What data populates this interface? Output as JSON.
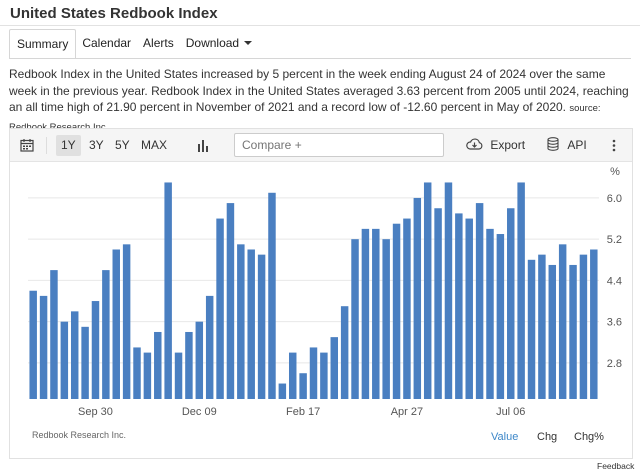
{
  "page": {
    "title": "United States Redbook Index"
  },
  "tabs": [
    {
      "label": "Summary",
      "active": true
    },
    {
      "label": "Calendar"
    },
    {
      "label": "Alerts"
    },
    {
      "label": "Download",
      "dropdown": true
    }
  ],
  "description": {
    "text": "Redbook Index in the United States increased by 5 percent in the week ending August 24 of 2024 over the same week in the previous year. Redbook Index in the United States averaged 3.63 percent from 2005 until 2024, reaching an all time high of 21.90 percent in November of 2021 and a record low of -12.60 percent in May of 2020.",
    "source": "source: Redbook Research Inc."
  },
  "toolbar": {
    "ranges": [
      "1Y",
      "3Y",
      "5Y",
      "MAX"
    ],
    "active_range": "1Y",
    "compare_placeholder": "Compare +",
    "export_label": "Export",
    "api_label": "API",
    "icons": [
      "calendar-icon",
      "bar-chart-icon",
      "cloud-download-icon",
      "database-icon",
      "more-vert-icon"
    ]
  },
  "chart_footer": {
    "source": "Redbook Research Inc.",
    "modes": [
      "Value",
      "Chg",
      "Chg%"
    ],
    "active_mode": "Value"
  },
  "feedback": "Feedback",
  "colors": {
    "bar": "#4a7fc1",
    "accent": "#3d87c8"
  },
  "chart_data": {
    "type": "bar",
    "unit": "%",
    "y_ticks": [
      2.8,
      3.6,
      4.4,
      5.2,
      6.0
    ],
    "x_tick_labels": [
      "Sep 30",
      "Dec 09",
      "Feb 17",
      "Apr 27",
      "Jul 06"
    ],
    "x_tick_bar_index": [
      6,
      16,
      26,
      36,
      46
    ],
    "ylim": [
      2.1,
      6.6
    ],
    "grid": true,
    "values": [
      4.2,
      4.1,
      4.6,
      3.6,
      3.8,
      3.5,
      4.0,
      4.6,
      5.0,
      5.1,
      3.1,
      3.0,
      3.4,
      6.3,
      3.0,
      3.4,
      3.6,
      4.1,
      5.6,
      5.9,
      5.1,
      5.0,
      4.9,
      6.1,
      2.4,
      3.0,
      2.6,
      3.1,
      3.0,
      3.3,
      3.9,
      5.2,
      5.4,
      5.4,
      5.2,
      5.5,
      5.6,
      6.0,
      6.3,
      5.8,
      6.3,
      5.7,
      5.6,
      5.9,
      5.4,
      5.3,
      5.8,
      6.3,
      4.8,
      4.9,
      4.7,
      5.1,
      4.7,
      4.9,
      5.0
    ]
  }
}
